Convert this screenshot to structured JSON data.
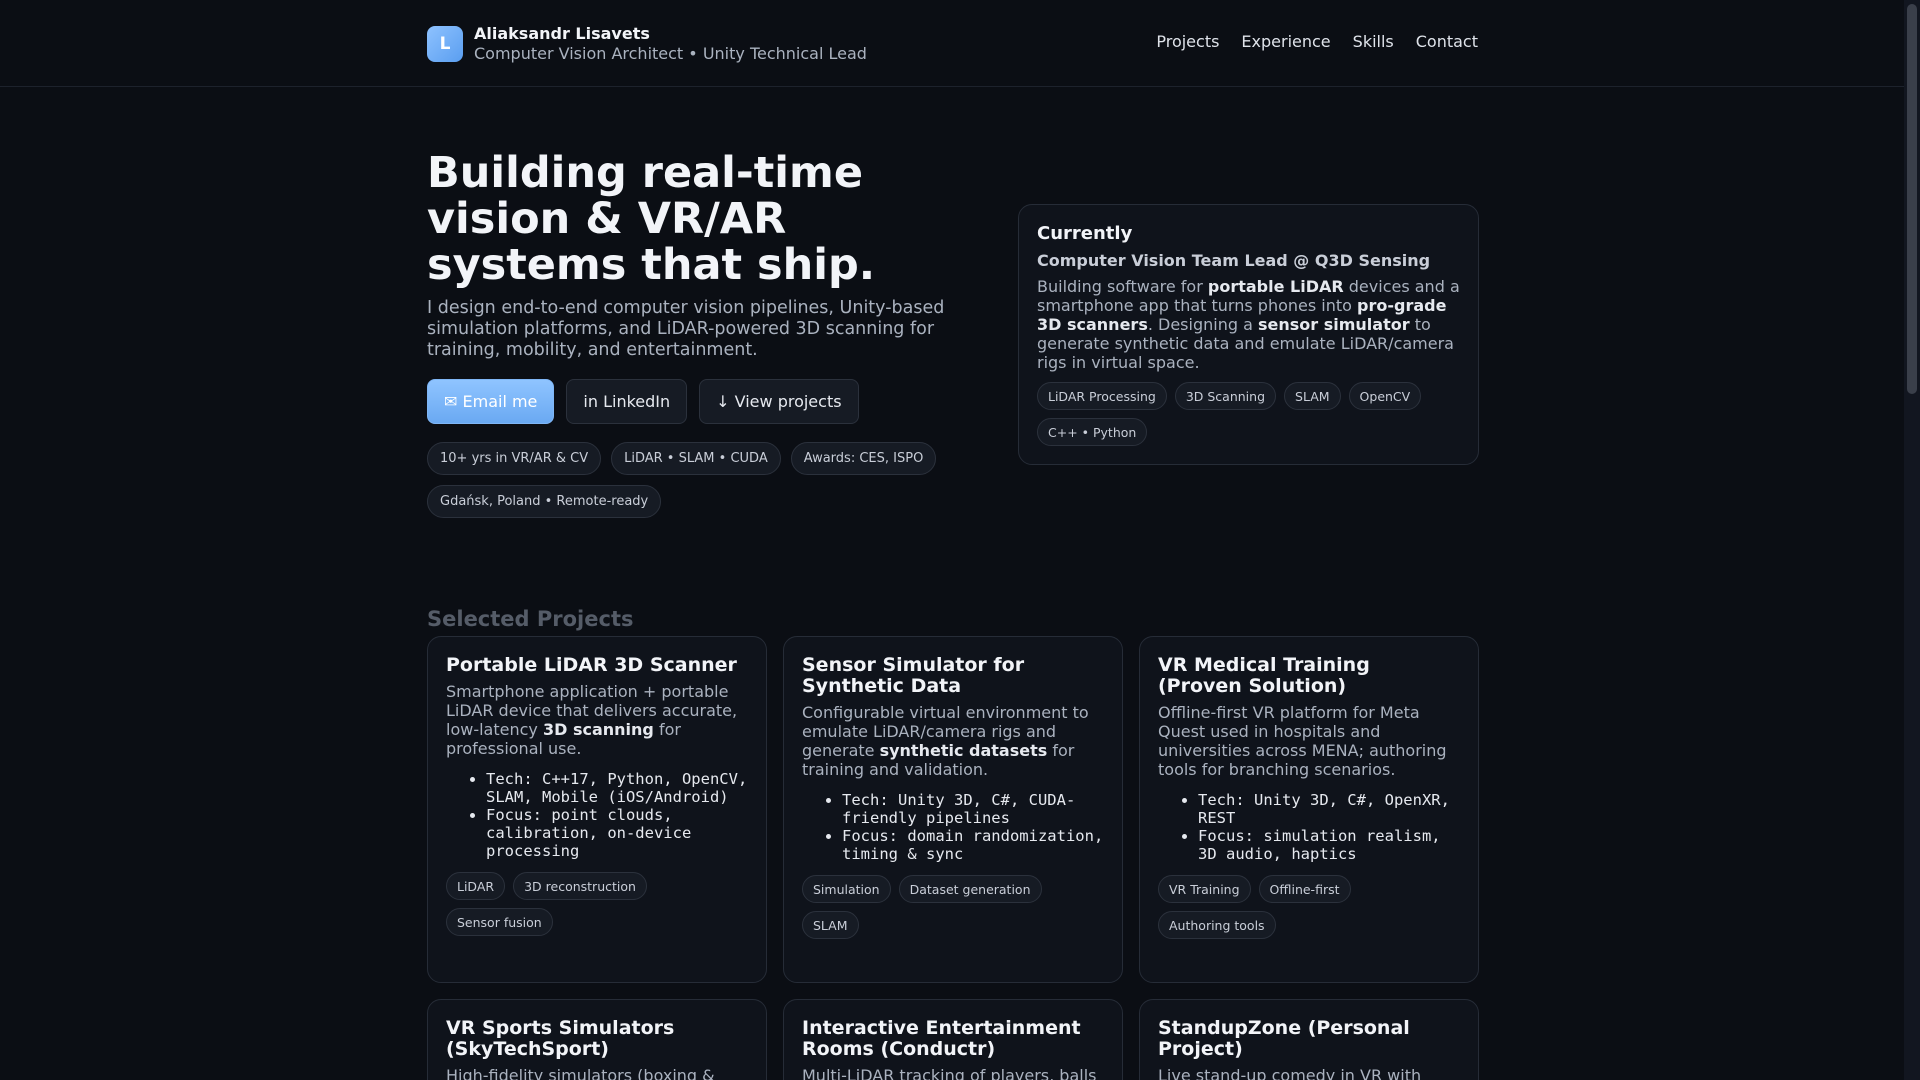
{
  "header": {
    "logo_letter": "L",
    "name": "Aliaksandr Lisavets",
    "subtitle": "Computer Vision Architect • Unity Technical Lead",
    "nav": [
      "Projects",
      "Experience",
      "Skills",
      "Contact"
    ]
  },
  "hero": {
    "title": "Building real-time vision & VR/AR systems that ship.",
    "lead": "I design end-to-end computer vision pipelines, Unity-based simulation platforms, and LiDAR-powered 3D scanning for training, mobility, and entertainment.",
    "buttons": {
      "email": "✉ Email me",
      "linkedin": "in LinkedIn",
      "projects": "↓ View projects"
    },
    "tags": [
      "10+ yrs in VR/AR & CV",
      "LiDAR • SLAM • CUDA",
      "Awards: CES, ISPO",
      "Gdańsk, Poland • Remote-ready"
    ]
  },
  "current": {
    "heading": "Currently",
    "role": "Computer Vision Team Lead @ Q3D Sensing",
    "desc_parts": [
      "Building software for ",
      "portable LiDAR",
      " devices and a smartphone app that turns phones into ",
      "pro-grade 3D scanners",
      ". Designing a ",
      "sensor simulator",
      " to generate synthetic data and emulate LiDAR/camera rigs in virtual space."
    ],
    "tags": [
      "LiDAR Processing",
      "3D Scanning",
      "SLAM",
      "OpenCV",
      "C++ • Python"
    ]
  },
  "projects": {
    "section_title": "Selected Projects",
    "cards": [
      {
        "title": "Portable LiDAR 3D Scanner",
        "desc_parts": [
          "Smartphone application + portable LiDAR device that delivers accurate, low-latency ",
          "3D scanning",
          " for professional use."
        ],
        "bullets": [
          "Tech: C++17, Python, OpenCV, SLAM, Mobile (iOS/Android)",
          "Focus: point clouds, calibration, on-device processing"
        ],
        "tags": [
          "LiDAR",
          "3D reconstruction",
          "Sensor fusion"
        ]
      },
      {
        "title": "Sensor Simulator for Synthetic Data",
        "desc_parts": [
          "Configurable virtual environment to emulate LiDAR/camera rigs and generate ",
          "synthetic datasets",
          " for training and validation."
        ],
        "bullets": [
          "Tech: Unity 3D, C#, CUDA-friendly pipelines",
          "Focus: domain randomization, timing & sync"
        ],
        "tags": [
          "Simulation",
          "Dataset generation",
          "SLAM"
        ]
      },
      {
        "title": "VR Medical Training (Proven Solution)",
        "desc_parts": [
          "Offline-first VR platform for Meta Quest used in hospitals and universities across MENA; authoring tools for branching scenarios.",
          "",
          ""
        ],
        "bullets": [
          "Tech: Unity 3D, C#, OpenXR, REST",
          "Focus: simulation realism, 3D audio, haptics"
        ],
        "tags": [
          "VR Training",
          "Offline-first",
          "Authoring tools"
        ]
      },
      {
        "title": "VR Sports Simulators (SkyTechSport)",
        "desc_parts": [
          "High-fidelity simulators (boxing & ",
          "",
          ""
        ],
        "bullets": [],
        "tags": []
      },
      {
        "title": "Interactive Entertainment Rooms (Conductr)",
        "desc_parts": [
          "Multi-LiDAR tracking of players, balls",
          "",
          ""
        ],
        "bullets": [],
        "tags": []
      },
      {
        "title": "StandupZone (Personal Project)",
        "desc_parts": [
          "Live stand-up comedy in VR with",
          "",
          ""
        ],
        "bullets": [],
        "tags": []
      }
    ]
  }
}
